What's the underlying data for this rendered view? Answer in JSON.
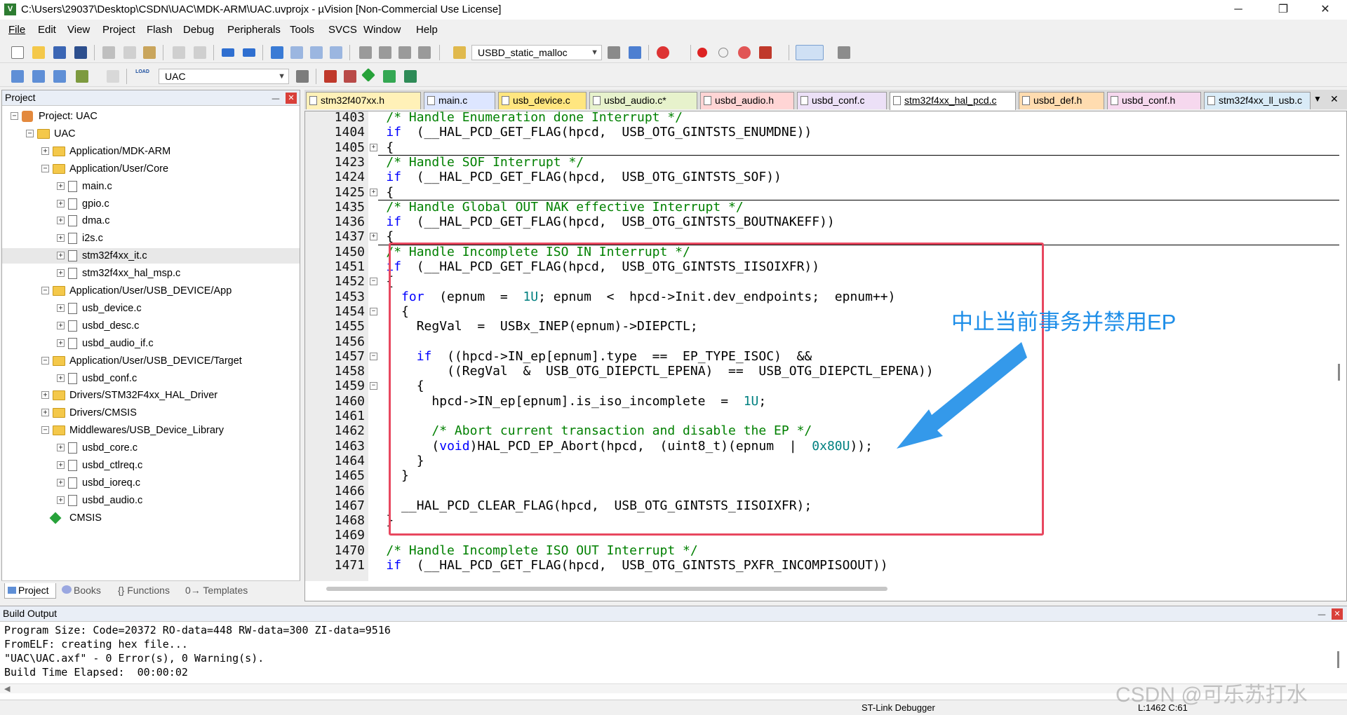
{
  "window": {
    "title": "C:\\Users\\29037\\Desktop\\CSDN\\UAC\\MDK-ARM\\UAC.uvprojx - µVision  [Non-Commercial Use License]",
    "minimize": "─",
    "maximize": "❐",
    "close": "✕"
  },
  "menu": [
    "File",
    "Edit",
    "View",
    "Project",
    "Flash",
    "Debug",
    "Peripherals",
    "Tools",
    "SVCS",
    "Window",
    "Help"
  ],
  "toolbar": {
    "target_combo": "USBD_static_malloc",
    "target_select": "UAC",
    "load_label": "LOAD"
  },
  "project_panel": {
    "title": "Project",
    "pin": "ᅳ",
    "close": "✕",
    "tree": [
      {
        "label": "Project: UAC",
        "level": 0,
        "type": "project",
        "exp": "−"
      },
      {
        "label": "UAC",
        "level": 1,
        "type": "folder",
        "exp": "−"
      },
      {
        "label": "Application/MDK-ARM",
        "level": 2,
        "type": "folder",
        "exp": "+"
      },
      {
        "label": "Application/User/Core",
        "level": 2,
        "type": "folder",
        "exp": "−"
      },
      {
        "label": "main.c",
        "level": 3,
        "type": "file",
        "exp": "+"
      },
      {
        "label": "gpio.c",
        "level": 3,
        "type": "file",
        "exp": "+"
      },
      {
        "label": "dma.c",
        "level": 3,
        "type": "file",
        "exp": "+"
      },
      {
        "label": "i2s.c",
        "level": 3,
        "type": "file",
        "exp": "+"
      },
      {
        "label": "stm32f4xx_it.c",
        "level": 3,
        "type": "file",
        "exp": "+",
        "selected": true
      },
      {
        "label": "stm32f4xx_hal_msp.c",
        "level": 3,
        "type": "file",
        "exp": "+"
      },
      {
        "label": "Application/User/USB_DEVICE/App",
        "level": 2,
        "type": "folder",
        "exp": "−"
      },
      {
        "label": "usb_device.c",
        "level": 3,
        "type": "file",
        "exp": "+"
      },
      {
        "label": "usbd_desc.c",
        "level": 3,
        "type": "file",
        "exp": "+"
      },
      {
        "label": "usbd_audio_if.c",
        "level": 3,
        "type": "file",
        "exp": "+"
      },
      {
        "label": "Application/User/USB_DEVICE/Target",
        "level": 2,
        "type": "folder",
        "exp": "−"
      },
      {
        "label": "usbd_conf.c",
        "level": 3,
        "type": "file",
        "exp": "+"
      },
      {
        "label": "Drivers/STM32F4xx_HAL_Driver",
        "level": 2,
        "type": "folder",
        "exp": "+"
      },
      {
        "label": "Drivers/CMSIS",
        "level": 2,
        "type": "folder",
        "exp": "+"
      },
      {
        "label": "Middlewares/USB_Device_Library",
        "level": 2,
        "type": "folder",
        "exp": "−"
      },
      {
        "label": "usbd_core.c",
        "level": 3,
        "type": "file",
        "exp": "+"
      },
      {
        "label": "usbd_ctlreq.c",
        "level": 3,
        "type": "file",
        "exp": "+"
      },
      {
        "label": "usbd_ioreq.c",
        "level": 3,
        "type": "file",
        "exp": "+"
      },
      {
        "label": "usbd_audio.c",
        "level": 3,
        "type": "file",
        "exp": "+"
      },
      {
        "label": "CMSIS",
        "level": 2,
        "type": "gem",
        "exp": ""
      }
    ],
    "tabs": [
      "Project",
      "Books",
      "{} Functions",
      "0→ Templates"
    ]
  },
  "editor": {
    "tabs": [
      {
        "label": "stm32f407xx.h",
        "color": "#fff1b8"
      },
      {
        "label": "main.c",
        "color": "#dde6ff"
      },
      {
        "label": "usb_device.c",
        "color": "#ffe680"
      },
      {
        "label": "usbd_audio.c*",
        "color": "#e7f2cc"
      },
      {
        "label": "usbd_audio.h",
        "color": "#ffd5d5"
      },
      {
        "label": "usbd_conf.c",
        "color": "#ece0f7"
      },
      {
        "label": "stm32f4xx_hal_pcd.c",
        "color": "#e2f2e2",
        "active": true
      },
      {
        "label": "usbd_def.h",
        "color": "#ffdcb0"
      },
      {
        "label": "usbd_conf.h",
        "color": "#f6d8ee"
      },
      {
        "label": "stm32f4xx_ll_usb.c",
        "color": "#d9ebf7"
      }
    ],
    "tab_menu": "▼",
    "tab_close": "✕",
    "lines": [
      {
        "n": "1403",
        "fold": "",
        "sep": false,
        "ind": 4,
        "parts": [
          [
            "cm",
            "/* Handle Enumeration done Interrupt */"
          ]
        ]
      },
      {
        "n": "1404",
        "fold": "",
        "sep": false,
        "ind": 4,
        "parts": [
          [
            "kw",
            "if"
          ],
          [
            "",
            "  (__HAL_PCD_GET_FLAG(hpcd,  USB_OTG_GINTSTS_ENUMDNE))"
          ]
        ]
      },
      {
        "n": "1405",
        "fold": "+",
        "sep": true,
        "ind": 4,
        "parts": [
          [
            "",
            "{"
          ]
        ]
      },
      {
        "n": "1423",
        "fold": "",
        "sep": false,
        "ind": 4,
        "parts": [
          [
            "cm",
            "/* Handle SOF Interrupt */"
          ]
        ]
      },
      {
        "n": "1424",
        "fold": "",
        "sep": false,
        "ind": 4,
        "parts": [
          [
            "kw",
            "if"
          ],
          [
            "",
            "  (__HAL_PCD_GET_FLAG(hpcd,  USB_OTG_GINTSTS_SOF))"
          ]
        ]
      },
      {
        "n": "1425",
        "fold": "+",
        "sep": true,
        "ind": 4,
        "parts": [
          [
            "",
            "{"
          ]
        ]
      },
      {
        "n": "1435",
        "fold": "",
        "sep": false,
        "ind": 4,
        "parts": [
          [
            "cm",
            "/* Handle Global OUT NAK effective Interrupt */"
          ]
        ]
      },
      {
        "n": "1436",
        "fold": "",
        "sep": false,
        "ind": 4,
        "parts": [
          [
            "kw",
            "if"
          ],
          [
            "",
            "  (__HAL_PCD_GET_FLAG(hpcd,  USB_OTG_GINTSTS_BOUTNAKEFF))"
          ]
        ]
      },
      {
        "n": "1437",
        "fold": "+",
        "sep": true,
        "ind": 4,
        "parts": [
          [
            "",
            "{"
          ]
        ]
      },
      {
        "n": "1450",
        "fold": "",
        "sep": false,
        "ind": 4,
        "parts": [
          [
            "cm",
            "/* Handle Incomplete ISO IN Interrupt */"
          ]
        ]
      },
      {
        "n": "1451",
        "fold": "",
        "sep": false,
        "ind": 4,
        "parts": [
          [
            "kw",
            "if"
          ],
          [
            "",
            "  (__HAL_PCD_GET_FLAG(hpcd,  USB_OTG_GINTSTS_IISOIXFR))"
          ]
        ]
      },
      {
        "n": "1452",
        "fold": "−",
        "sep": false,
        "ind": 4,
        "parts": [
          [
            "",
            "{"
          ]
        ]
      },
      {
        "n": "1453",
        "fold": "",
        "sep": false,
        "ind": 6,
        "parts": [
          [
            "kw",
            "for"
          ],
          [
            "",
            "  (epnum  =  "
          ],
          [
            "num",
            "1U"
          ],
          [
            "",
            "; epnum  <  hpcd->Init.dev_endpoints;  epnum++)"
          ]
        ]
      },
      {
        "n": "1454",
        "fold": "−",
        "sep": false,
        "ind": 6,
        "parts": [
          [
            "",
            "{"
          ]
        ]
      },
      {
        "n": "1455",
        "fold": "",
        "sep": false,
        "ind": 8,
        "parts": [
          [
            "",
            "RegVal  =  USBx_INEP(epnum)->DIEPCTL;"
          ]
        ]
      },
      {
        "n": "1456",
        "fold": "",
        "sep": false,
        "ind": 8,
        "parts": [
          [
            "",
            ""
          ]
        ]
      },
      {
        "n": "1457",
        "fold": "−",
        "sep": false,
        "ind": 8,
        "parts": [
          [
            "kw",
            "if"
          ],
          [
            "",
            "  ((hpcd->IN_ep[epnum].type  ==  EP_TYPE_ISOC)  &&"
          ]
        ]
      },
      {
        "n": "1458",
        "fold": "",
        "sep": false,
        "ind": 12,
        "parts": [
          [
            "",
            "((RegVal  &  USB_OTG_DIEPCTL_EPENA)  ==  USB_OTG_DIEPCTL_EPENA))"
          ]
        ]
      },
      {
        "n": "1459",
        "fold": "−",
        "sep": false,
        "ind": 8,
        "parts": [
          [
            "",
            "{"
          ]
        ]
      },
      {
        "n": "1460",
        "fold": "",
        "sep": false,
        "ind": 10,
        "parts": [
          [
            "",
            "hpcd->IN_ep[epnum].is_iso_incomplete  =  "
          ],
          [
            "num",
            "1U"
          ],
          [
            "",
            ";"
          ]
        ]
      },
      {
        "n": "1461",
        "fold": "",
        "sep": false,
        "ind": 10,
        "parts": [
          [
            "",
            ""
          ]
        ]
      },
      {
        "n": "1462",
        "fold": "",
        "sep": false,
        "ind": 10,
        "parts": [
          [
            "cm",
            "/* Abort current transaction and disable the EP */"
          ]
        ]
      },
      {
        "n": "1463",
        "fold": "",
        "sep": false,
        "ind": 10,
        "parts": [
          [
            "",
            "("
          ],
          [
            "kw",
            "void"
          ],
          [
            "",
            ")HAL_PCD_EP_Abort(hpcd,  (uint8_t)(epnum  |  "
          ],
          [
            "num",
            "0x80U"
          ],
          [
            "",
            "));"
          ]
        ]
      },
      {
        "n": "1464",
        "fold": "",
        "sep": false,
        "ind": 8,
        "parts": [
          [
            "",
            "}"
          ]
        ]
      },
      {
        "n": "1465",
        "fold": "",
        "sep": false,
        "ind": 6,
        "parts": [
          [
            "",
            "}"
          ]
        ]
      },
      {
        "n": "1466",
        "fold": "",
        "sep": false,
        "ind": 6,
        "parts": [
          [
            "",
            ""
          ]
        ]
      },
      {
        "n": "1467",
        "fold": "",
        "sep": false,
        "ind": 6,
        "parts": [
          [
            "",
            "__HAL_PCD_CLEAR_FLAG(hpcd,  USB_OTG_GINTSTS_IISOIXFR);"
          ]
        ]
      },
      {
        "n": "1468",
        "fold": "",
        "sep": false,
        "ind": 4,
        "parts": [
          [
            "",
            "}"
          ]
        ]
      },
      {
        "n": "1469",
        "fold": "",
        "sep": false,
        "ind": 4,
        "parts": [
          [
            "",
            ""
          ]
        ]
      },
      {
        "n": "1470",
        "fold": "",
        "sep": false,
        "ind": 4,
        "parts": [
          [
            "cm",
            "/* Handle Incomplete ISO OUT Interrupt */"
          ]
        ]
      },
      {
        "n": "1471",
        "fold": "",
        "sep": false,
        "ind": 4,
        "parts": [
          [
            "kw",
            "if"
          ],
          [
            "",
            "  (__HAL_PCD_GET_FLAG(hpcd,  USB_OTG_GINTSTS_PXFR_INCOMPISOOUT))"
          ]
        ]
      }
    ]
  },
  "annotation": {
    "text": "中止当前事务并禁用EP",
    "color": "#1e8ee8"
  },
  "build_output": {
    "title": "Build Output",
    "lines": [
      "Program Size: Code=20372 RO-data=448 RW-data=300 ZI-data=9516",
      "FromELF: creating hex file...",
      "\"UAC\\UAC.axf\" - 0 Error(s), 0 Warning(s).",
      "Build Time Elapsed:  00:00:02"
    ]
  },
  "status": {
    "debugger": "ST-Link Debugger",
    "position": "L:1462 C:61"
  },
  "watermark": "CSDN @可乐苏打水"
}
